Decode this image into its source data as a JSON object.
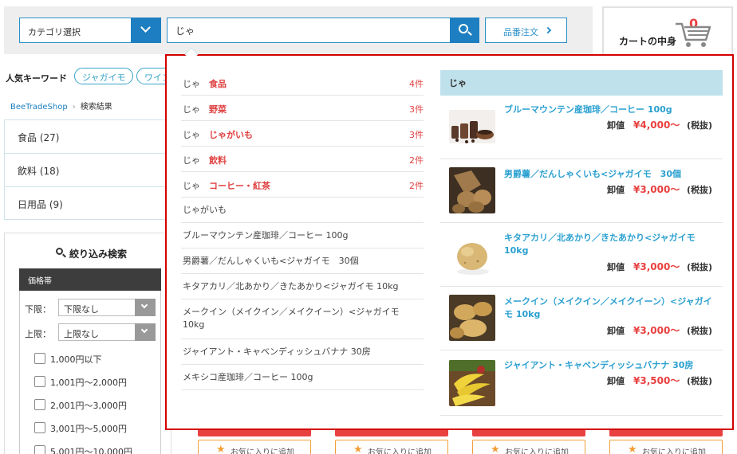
{
  "header": {
    "category_select": "カテゴリ選択",
    "search_value": "じゃ",
    "part_order_button": "品番注文",
    "cart_label": "カートの中身",
    "cart_count": "0"
  },
  "keywords": {
    "title": "人気キーワード",
    "items": [
      "ジャガイモ",
      "ワイン"
    ]
  },
  "breadcrumb": {
    "home": "BeeTradeShop",
    "current": "検索結果"
  },
  "categories": [
    {
      "label": "食品 (27)"
    },
    {
      "label": "飲料 (18)"
    },
    {
      "label": "日用品 (9)"
    }
  ],
  "filter": {
    "title": "絞り込み検索",
    "price_head": "価格帯",
    "lower_label": "下限：",
    "lower_value": "下限なし",
    "upper_label": "上限：",
    "upper_value": "上限なし",
    "ranges": [
      "1,000円以下",
      "1,001円～2,000円",
      "2,001円～3,000円",
      "3,001円～5,000円",
      "5,001円～10,000円"
    ]
  },
  "cards": {
    "fav_label": "お気に入りに追加"
  },
  "dropdown": {
    "category_suggestions": [
      {
        "query": "じゃ",
        "category": "食品",
        "count": "4件"
      },
      {
        "query": "じゃ",
        "category": "野菜",
        "count": "3件"
      },
      {
        "query": "じゃ",
        "category": "じゃがいも",
        "count": "3件"
      },
      {
        "query": "じゃ",
        "category": "飲料",
        "count": "2件"
      },
      {
        "query": "じゃ",
        "category": "コーヒー・紅茶",
        "count": "2件"
      }
    ],
    "keyword_suggestions": [
      "じゃがいも",
      "ブルーマウンテン産珈琲／コーヒー 100g",
      "男爵薯／だんしゃくいも<ジャガイモ　30個",
      "キタアカリ／北あかり／きたあかり<ジャガイモ 10kg",
      "メークイン（メイクイン／メイクイーン）<ジャガイモ 10kg",
      "ジャイアント・キャベンディッシュバナナ 30房",
      "メキシコ産珈琲／コーヒー 100g"
    ],
    "product_header": "じゃ",
    "products": [
      {
        "name": "ブルーマウンテン産珈琲／コーヒー 100g",
        "price_label": "卸値",
        "price": "¥4,000～",
        "tax": "(税抜)"
      },
      {
        "name": "男爵薯／だんしゃくいも<ジャガイモ　30個",
        "price_label": "卸値",
        "price": "¥3,000～",
        "tax": "(税抜)"
      },
      {
        "name": "キタアカリ／北あかり／きたあかり<ジャガイモ 10kg",
        "price_label": "卸値",
        "price": "¥3,000～",
        "tax": "(税抜)"
      },
      {
        "name": "メークイン（メイクイン／メイクイーン）<ジャガイモ 10kg",
        "price_label": "卸値",
        "price": "¥3,000～",
        "tax": "(税抜)"
      },
      {
        "name": "ジャイアント・キャベンディッシュバナナ 30房",
        "price_label": "卸値",
        "price": "¥3,500～",
        "tax": "(税抜)"
      }
    ]
  },
  "colors": {
    "accent_blue": "#1d7fc1",
    "link_cyan": "#2aa0d0",
    "price_red": "#e94040",
    "highlight_border": "#d40000"
  }
}
